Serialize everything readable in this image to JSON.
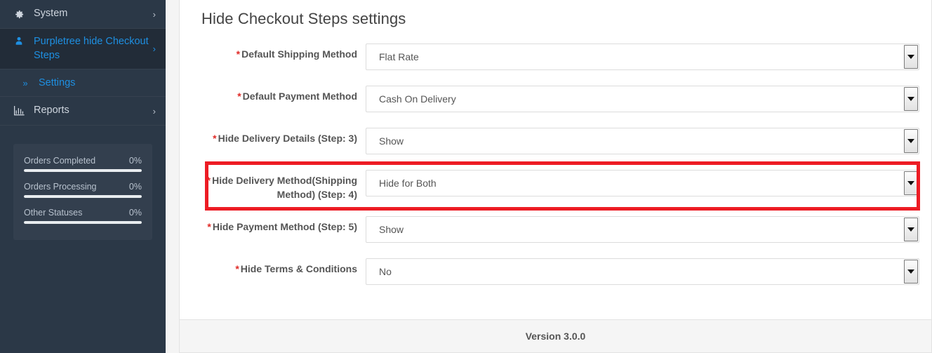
{
  "sidebar": {
    "items": [
      {
        "label": "System",
        "icon": "gear-icon",
        "chevron": "›",
        "name": "system"
      },
      {
        "label": "Purpletree hide Checkout Steps",
        "icon": "user-icon",
        "chevron": "›",
        "name": "purpletree-hide-checkout-steps"
      },
      {
        "label": "Settings",
        "icon": "double-chevron-right-icon",
        "name": "settings"
      },
      {
        "label": "Reports",
        "icon": "bar-chart-icon",
        "chevron": "›",
        "name": "reports"
      }
    ],
    "stats": [
      {
        "label": "Orders Completed",
        "value": "0%",
        "fill": 100
      },
      {
        "label": "Orders Processing",
        "value": "0%",
        "fill": 100
      },
      {
        "label": "Other Statuses",
        "value": "0%",
        "fill": 100
      }
    ]
  },
  "page": {
    "title": "Hide Checkout Steps settings",
    "footer": "Version 3.0.0"
  },
  "form": {
    "required_marker": "*",
    "rows": [
      {
        "label": "Default Shipping Method",
        "value": "Flat Rate",
        "options": [
          "Flat Rate"
        ],
        "name": "default-shipping-method"
      },
      {
        "label": "Default Payment Method",
        "value": "Cash On Delivery",
        "options": [
          "Cash On Delivery"
        ],
        "name": "default-payment-method"
      },
      {
        "label": "Hide Delivery Details (Step: 3)",
        "value": "Show",
        "options": [
          "Show"
        ],
        "name": "hide-delivery-details"
      },
      {
        "label": "Hide Delivery Method(Shipping Method) (Step: 4)",
        "value": "Hide for Both",
        "options": [
          "Hide for Both"
        ],
        "name": "hide-delivery-method",
        "highlighted": true
      },
      {
        "label": "Hide Payment Method (Step: 5)",
        "value": "Show",
        "options": [
          "Show"
        ],
        "name": "hide-payment-method"
      },
      {
        "label": "Hide Terms & Conditions",
        "value": "No",
        "options": [
          "No"
        ],
        "name": "hide-terms-conditions"
      }
    ]
  },
  "colors": {
    "sidebar_bg": "#2b3847",
    "accent_link": "#1e8fe1",
    "highlight_red": "#ed1c24",
    "required_red": "#e02b27"
  }
}
